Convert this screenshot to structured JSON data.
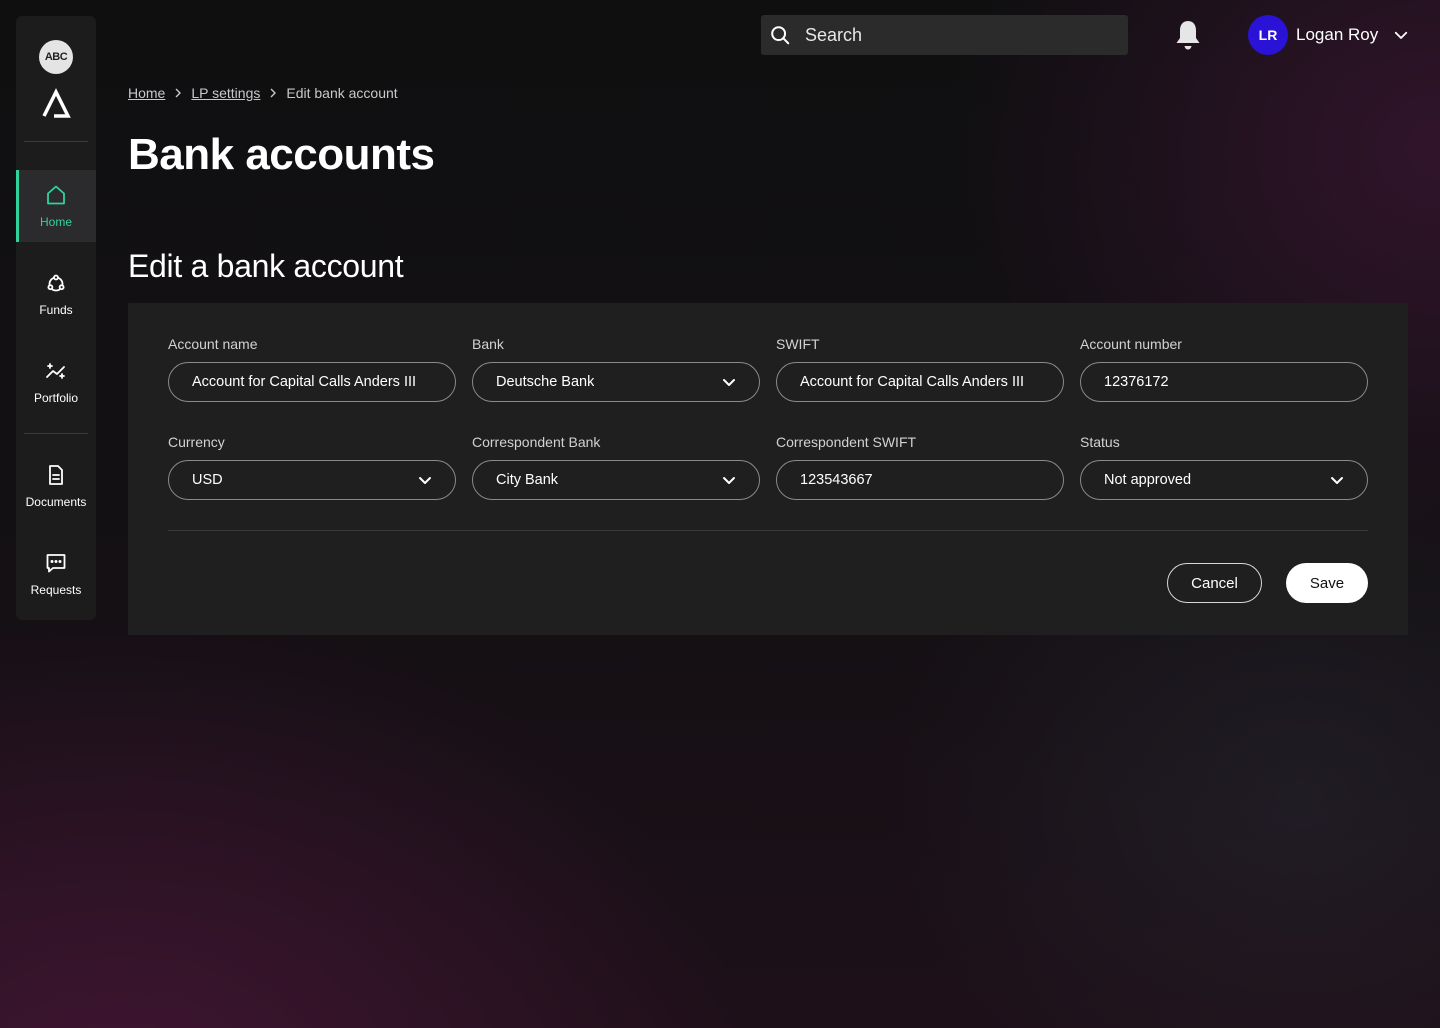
{
  "org": {
    "badge": "ABC"
  },
  "sidebar": {
    "items": [
      {
        "label": "Home",
        "icon": "home-icon",
        "active": true
      },
      {
        "label": "Funds",
        "icon": "funds-icon"
      },
      {
        "label": "Portfolio",
        "icon": "portfolio-icon"
      },
      {
        "label": "Documents",
        "icon": "document-icon"
      },
      {
        "label": "Requests",
        "icon": "chat-icon"
      }
    ]
  },
  "header": {
    "search_placeholder": "Search",
    "user": {
      "initials": "LR",
      "name": "Logan Roy"
    }
  },
  "breadcrumb": [
    "Home",
    "LP settings",
    "Edit bank account"
  ],
  "page_title": "Bank accounts",
  "form": {
    "title": "Edit a bank account",
    "fields": {
      "account_name": {
        "label": "Account name",
        "value": "Account for Capital Calls Anders III"
      },
      "bank": {
        "label": "Bank",
        "value": "Deutsche Bank"
      },
      "swift": {
        "label": "SWIFT",
        "value": "Account for Capital Calls Anders III"
      },
      "account_number": {
        "label": "Account number",
        "value": "12376172"
      },
      "currency": {
        "label": "Currency",
        "value": "USD"
      },
      "correspondent_bank": {
        "label": "Correspondent Bank",
        "value": "City Bank"
      },
      "correspondent_swift": {
        "label": "Correspondent SWIFT",
        "value": "123543667"
      },
      "status": {
        "label": "Status",
        "value": "Not approved"
      }
    },
    "cancel_label": "Cancel",
    "save_label": "Save"
  },
  "colors": {
    "accent": "#2fd39a",
    "avatar": "#2a12d6",
    "card": "#1f1f20"
  }
}
